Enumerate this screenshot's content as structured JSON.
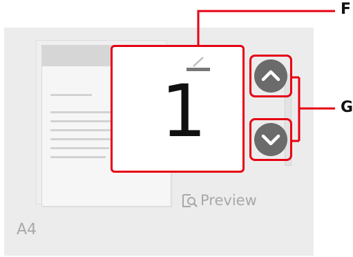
{
  "screen": {
    "paper_size": "A4",
    "preview_label": "Preview",
    "preview_icon": "preview-magnifier-icon"
  },
  "page_counter": {
    "current_page": "1",
    "total_mark_icon": "total-pages-mark-icon"
  },
  "navigation": {
    "up_icon": "chevron-up-icon",
    "down_icon": "chevron-down-icon"
  },
  "callouts": {
    "f": "F",
    "g": "G"
  },
  "colors": {
    "callout_red": "#e60012",
    "button_gray": "#6b6b6b",
    "screen_bg": "#ececec",
    "muted_text": "#a8a8a8"
  }
}
